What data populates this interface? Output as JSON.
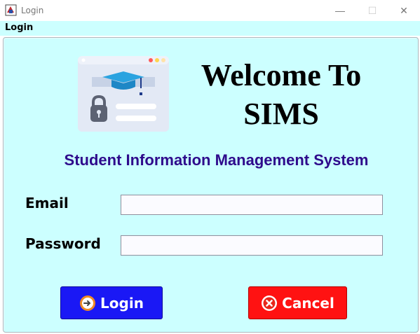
{
  "window": {
    "title": "Login",
    "controls": {
      "minimize": "—",
      "maximize": "☐",
      "close": "✕"
    }
  },
  "menubar": {
    "label": "Login"
  },
  "welcome": {
    "line1": "Welcome To",
    "line2": "SIMS"
  },
  "subtitle": "Student Information Management System",
  "form": {
    "email": {
      "label": "Email",
      "value": "",
      "placeholder": ""
    },
    "password": {
      "label": "Password",
      "value": "",
      "placeholder": ""
    }
  },
  "buttons": {
    "login": {
      "label": "Login",
      "icon": "arrow-right-circle-icon"
    },
    "cancel": {
      "label": "Cancel",
      "icon": "close-circle-icon"
    }
  },
  "colors": {
    "background": "#ccffff",
    "subtitle": "#2e0a8c",
    "login_button": "#1a18f5",
    "cancel_button": "#ff1212"
  }
}
